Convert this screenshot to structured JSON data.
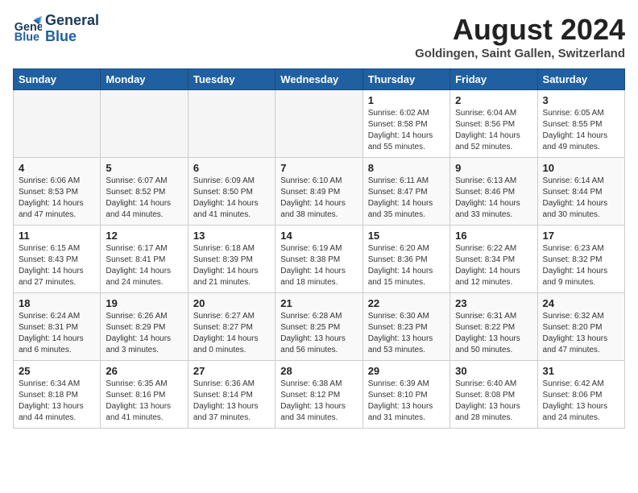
{
  "logo": {
    "line1": "General",
    "line2": "Blue"
  },
  "title": "August 2024",
  "subtitle": "Goldingen, Saint Gallen, Switzerland",
  "days_of_week": [
    "Sunday",
    "Monday",
    "Tuesday",
    "Wednesday",
    "Thursday",
    "Friday",
    "Saturday"
  ],
  "weeks": [
    [
      {
        "day": "",
        "info": ""
      },
      {
        "day": "",
        "info": ""
      },
      {
        "day": "",
        "info": ""
      },
      {
        "day": "",
        "info": ""
      },
      {
        "day": "1",
        "info": "Sunrise: 6:02 AM\nSunset: 8:58 PM\nDaylight: 14 hours\nand 55 minutes."
      },
      {
        "day": "2",
        "info": "Sunrise: 6:04 AM\nSunset: 8:56 PM\nDaylight: 14 hours\nand 52 minutes."
      },
      {
        "day": "3",
        "info": "Sunrise: 6:05 AM\nSunset: 8:55 PM\nDaylight: 14 hours\nand 49 minutes."
      }
    ],
    [
      {
        "day": "4",
        "info": "Sunrise: 6:06 AM\nSunset: 8:53 PM\nDaylight: 14 hours\nand 47 minutes."
      },
      {
        "day": "5",
        "info": "Sunrise: 6:07 AM\nSunset: 8:52 PM\nDaylight: 14 hours\nand 44 minutes."
      },
      {
        "day": "6",
        "info": "Sunrise: 6:09 AM\nSunset: 8:50 PM\nDaylight: 14 hours\nand 41 minutes."
      },
      {
        "day": "7",
        "info": "Sunrise: 6:10 AM\nSunset: 8:49 PM\nDaylight: 14 hours\nand 38 minutes."
      },
      {
        "day": "8",
        "info": "Sunrise: 6:11 AM\nSunset: 8:47 PM\nDaylight: 14 hours\nand 35 minutes."
      },
      {
        "day": "9",
        "info": "Sunrise: 6:13 AM\nSunset: 8:46 PM\nDaylight: 14 hours\nand 33 minutes."
      },
      {
        "day": "10",
        "info": "Sunrise: 6:14 AM\nSunset: 8:44 PM\nDaylight: 14 hours\nand 30 minutes."
      }
    ],
    [
      {
        "day": "11",
        "info": "Sunrise: 6:15 AM\nSunset: 8:43 PM\nDaylight: 14 hours\nand 27 minutes."
      },
      {
        "day": "12",
        "info": "Sunrise: 6:17 AM\nSunset: 8:41 PM\nDaylight: 14 hours\nand 24 minutes."
      },
      {
        "day": "13",
        "info": "Sunrise: 6:18 AM\nSunset: 8:39 PM\nDaylight: 14 hours\nand 21 minutes."
      },
      {
        "day": "14",
        "info": "Sunrise: 6:19 AM\nSunset: 8:38 PM\nDaylight: 14 hours\nand 18 minutes."
      },
      {
        "day": "15",
        "info": "Sunrise: 6:20 AM\nSunset: 8:36 PM\nDaylight: 14 hours\nand 15 minutes."
      },
      {
        "day": "16",
        "info": "Sunrise: 6:22 AM\nSunset: 8:34 PM\nDaylight: 14 hours\nand 12 minutes."
      },
      {
        "day": "17",
        "info": "Sunrise: 6:23 AM\nSunset: 8:32 PM\nDaylight: 14 hours\nand 9 minutes."
      }
    ],
    [
      {
        "day": "18",
        "info": "Sunrise: 6:24 AM\nSunset: 8:31 PM\nDaylight: 14 hours\nand 6 minutes."
      },
      {
        "day": "19",
        "info": "Sunrise: 6:26 AM\nSunset: 8:29 PM\nDaylight: 14 hours\nand 3 minutes."
      },
      {
        "day": "20",
        "info": "Sunrise: 6:27 AM\nSunset: 8:27 PM\nDaylight: 14 hours\nand 0 minutes."
      },
      {
        "day": "21",
        "info": "Sunrise: 6:28 AM\nSunset: 8:25 PM\nDaylight: 13 hours\nand 56 minutes."
      },
      {
        "day": "22",
        "info": "Sunrise: 6:30 AM\nSunset: 8:23 PM\nDaylight: 13 hours\nand 53 minutes."
      },
      {
        "day": "23",
        "info": "Sunrise: 6:31 AM\nSunset: 8:22 PM\nDaylight: 13 hours\nand 50 minutes."
      },
      {
        "day": "24",
        "info": "Sunrise: 6:32 AM\nSunset: 8:20 PM\nDaylight: 13 hours\nand 47 minutes."
      }
    ],
    [
      {
        "day": "25",
        "info": "Sunrise: 6:34 AM\nSunset: 8:18 PM\nDaylight: 13 hours\nand 44 minutes."
      },
      {
        "day": "26",
        "info": "Sunrise: 6:35 AM\nSunset: 8:16 PM\nDaylight: 13 hours\nand 41 minutes."
      },
      {
        "day": "27",
        "info": "Sunrise: 6:36 AM\nSunset: 8:14 PM\nDaylight: 13 hours\nand 37 minutes."
      },
      {
        "day": "28",
        "info": "Sunrise: 6:38 AM\nSunset: 8:12 PM\nDaylight: 13 hours\nand 34 minutes."
      },
      {
        "day": "29",
        "info": "Sunrise: 6:39 AM\nSunset: 8:10 PM\nDaylight: 13 hours\nand 31 minutes."
      },
      {
        "day": "30",
        "info": "Sunrise: 6:40 AM\nSunset: 8:08 PM\nDaylight: 13 hours\nand 28 minutes."
      },
      {
        "day": "31",
        "info": "Sunrise: 6:42 AM\nSunset: 8:06 PM\nDaylight: 13 hours\nand 24 minutes."
      }
    ]
  ]
}
